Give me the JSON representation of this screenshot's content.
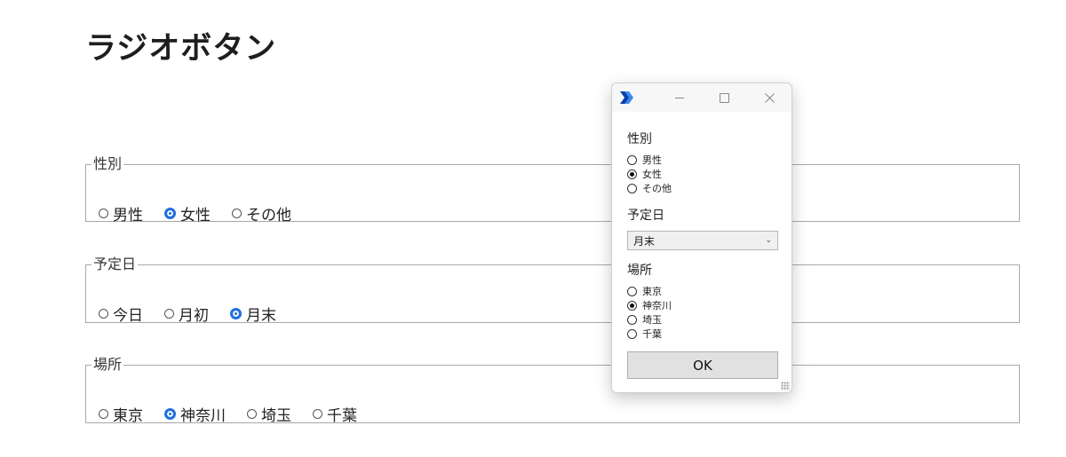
{
  "page": {
    "title": "ラジオボタン"
  },
  "groups": [
    {
      "legend": "性別",
      "options": [
        {
          "label": "男性",
          "checked": false
        },
        {
          "label": "女性",
          "checked": true
        },
        {
          "label": "その他",
          "checked": false
        }
      ]
    },
    {
      "legend": "予定日",
      "options": [
        {
          "label": "今日",
          "checked": false
        },
        {
          "label": "月初",
          "checked": false
        },
        {
          "label": "月末",
          "checked": true
        }
      ]
    },
    {
      "legend": "場所",
      "options": [
        {
          "label": "東京",
          "checked": false
        },
        {
          "label": "神奈川",
          "checked": true
        },
        {
          "label": "埼玉",
          "checked": false
        },
        {
          "label": "千葉",
          "checked": false
        }
      ]
    }
  ],
  "dialog": {
    "app_icon": "power-automate-icon",
    "gender_label": "性別",
    "gender_options": [
      {
        "label": "男性",
        "checked": false
      },
      {
        "label": "女性",
        "checked": true
      },
      {
        "label": "その他",
        "checked": false
      }
    ],
    "date_label": "予定日",
    "date_select_value": "月末",
    "place_label": "場所",
    "place_options": [
      {
        "label": "東京",
        "checked": false
      },
      {
        "label": "神奈川",
        "checked": true
      },
      {
        "label": "埼玉",
        "checked": false
      },
      {
        "label": "千葉",
        "checked": false
      }
    ],
    "ok_label": "OK"
  },
  "colors": {
    "accent": "#1f6fe0",
    "border": "#a8a8a8"
  }
}
